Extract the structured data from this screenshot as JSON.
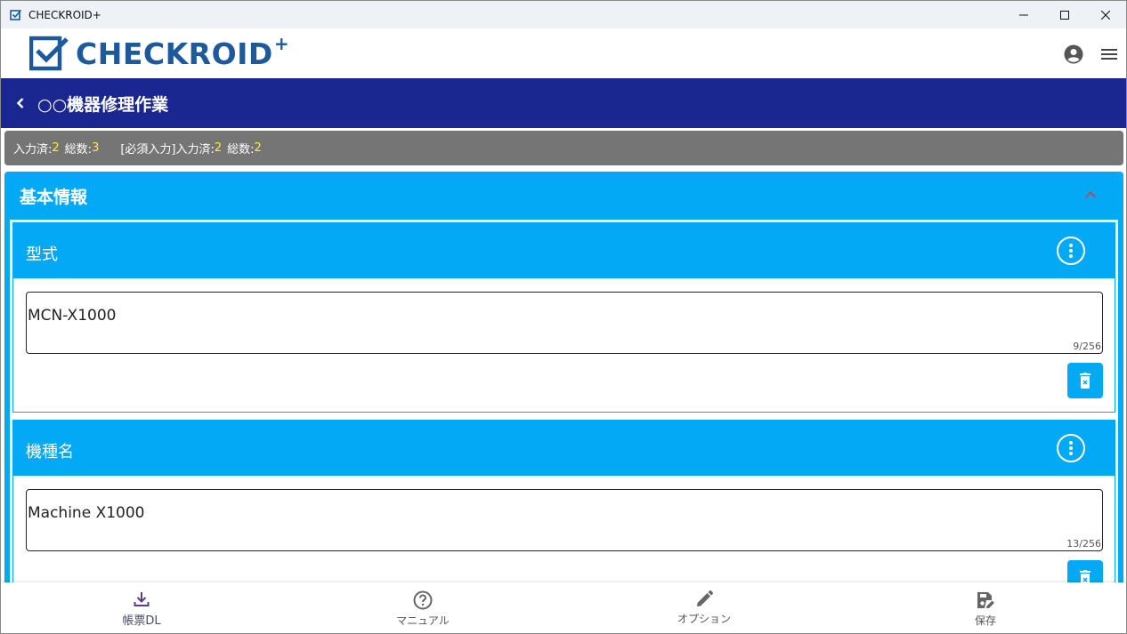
{
  "window": {
    "title": "CHECKROID+"
  },
  "header": {
    "logo_text": "CHECKROID",
    "logo_plus": "+"
  },
  "page": {
    "title": "○○機器修理作業"
  },
  "status": {
    "entered_label": "入力済:",
    "entered_value": "2",
    "total_label": "総数:",
    "total_value": "3",
    "required_label": "[必須入力]入力済:",
    "required_entered_value": "2",
    "required_total_label": "総数:",
    "required_total_value": "2"
  },
  "section": {
    "title": "基本情報",
    "fields": [
      {
        "label": "型式",
        "value": "MCN-X1000",
        "counter": "9/256"
      },
      {
        "label": "機種名",
        "value": "Machine X1000",
        "counter": "13/256"
      }
    ]
  },
  "bottom_nav": {
    "items": [
      {
        "label": "帳票DL",
        "icon": "download-icon"
      },
      {
        "label": "マニュアル",
        "icon": "help-circle-icon"
      },
      {
        "label": "オプション",
        "icon": "pencil-icon"
      },
      {
        "label": "保存",
        "icon": "save-edit-icon"
      }
    ]
  },
  "colors": {
    "primary_dark": "#1a2791",
    "accent": "#03a9f4",
    "status_bg": "#757575",
    "status_number": "#ffeb3b",
    "logo": "#1c5a9c"
  }
}
